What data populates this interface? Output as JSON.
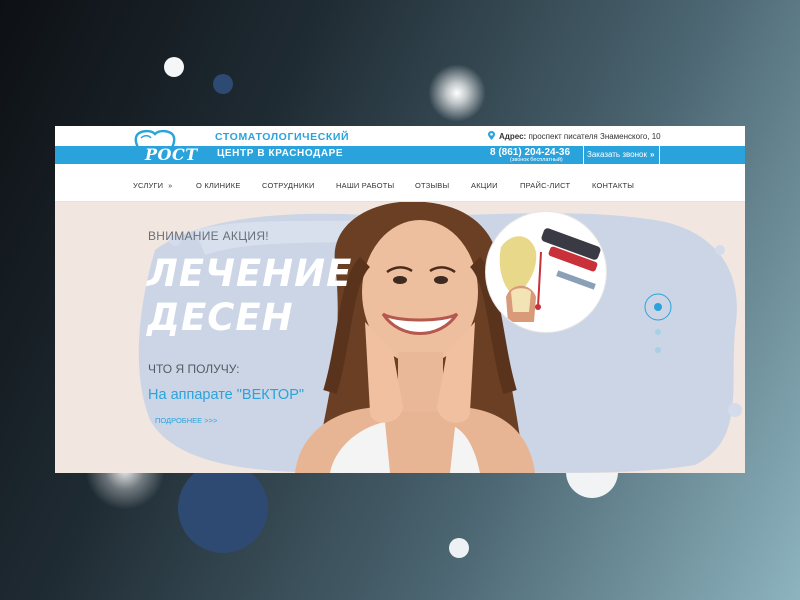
{
  "brand": {
    "logo_text": "РОСТ",
    "tagline_top": "стоматологический",
    "tagline_bottom": "центр в Краснодаре"
  },
  "contact": {
    "address_label": "Адрес:",
    "address_value": "проспект писателя Знаменского, 10",
    "phone": "8 (861) 204-24-36",
    "phone_note": "(звонок бесплатный)",
    "callback_label": "Заказать звонок",
    "callback_arrow": "»"
  },
  "nav": {
    "items": [
      {
        "label": "Услуги",
        "has_dropdown": true
      },
      {
        "label": "О клинике"
      },
      {
        "label": "Сотрудники"
      },
      {
        "label": "Наши работы"
      },
      {
        "label": "Отзывы"
      },
      {
        "label": "Акции"
      },
      {
        "label": "Прайс-лист"
      },
      {
        "label": "Контакты"
      }
    ],
    "dropdown_icon": "»"
  },
  "hero": {
    "promo_label": "Внимание акция!",
    "headline_line1": "Лечение",
    "headline_line2": "десен",
    "question": "Что я получу:",
    "device_text": "На аппарате \"ВЕКТОР\"",
    "more_link": "подробнее >>>"
  },
  "colors": {
    "accent": "#2aa3dc",
    "hero_bg": "#f1e7e0",
    "bokeh_dark": "#2e4a73"
  },
  "icons": [
    "location-pin-icon",
    "tooth-logo-icon",
    "chevron-right-icon",
    "slider-dot-icon"
  ]
}
